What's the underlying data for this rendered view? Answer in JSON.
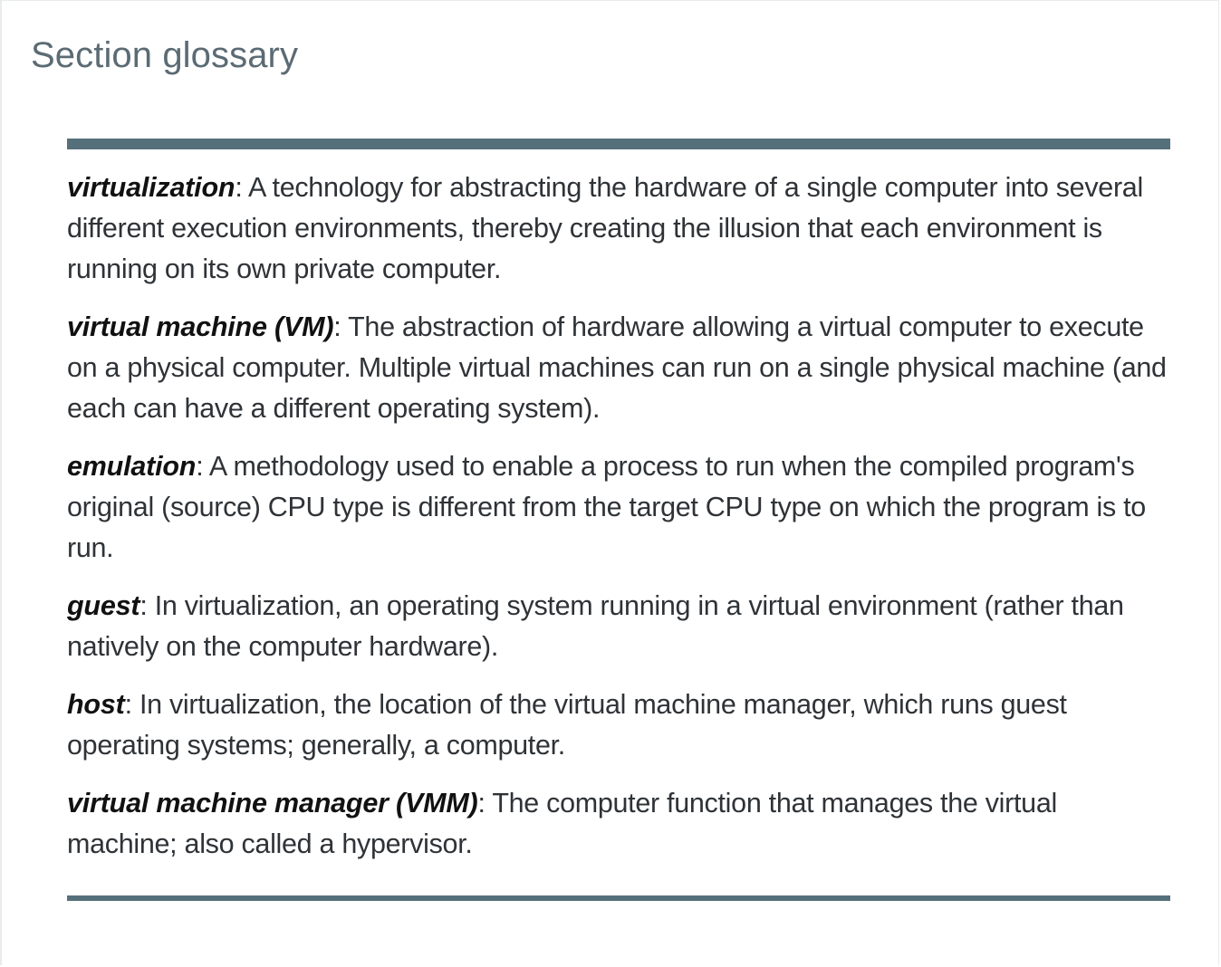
{
  "section": {
    "title": "Section glossary"
  },
  "glossary": [
    {
      "term": "virtualization",
      "definition": "A technology for abstracting the hardware of a single computer into several different execution environments, thereby creating the illusion that each environment is running on its own private computer."
    },
    {
      "term": "virtual machine (VM)",
      "definition": "The abstraction of hardware allowing a virtual computer to execute on a physical computer. Multiple virtual machines can run on a single physical machine (and each can have a different operating system)."
    },
    {
      "term": "emulation",
      "definition": "A methodology used to enable a process to run when the compiled program's original (source) CPU type is different from the target CPU type on which the program is to run."
    },
    {
      "term": "guest",
      "definition": "In virtualization, an operating system running in a virtual environment (rather than natively on the computer hardware)."
    },
    {
      "term": "host",
      "definition": "In virtualization, the location of the virtual machine manager, which runs guest operating systems; generally, a computer."
    },
    {
      "term": "virtual machine manager (VMM)",
      "definition": "The computer function that manages the virtual machine; also called a hypervisor."
    }
  ],
  "separator": ": ",
  "colors": {
    "title": "#5b6b74",
    "rule": "#56707b",
    "text": "#2f3337",
    "term": "#111111"
  }
}
